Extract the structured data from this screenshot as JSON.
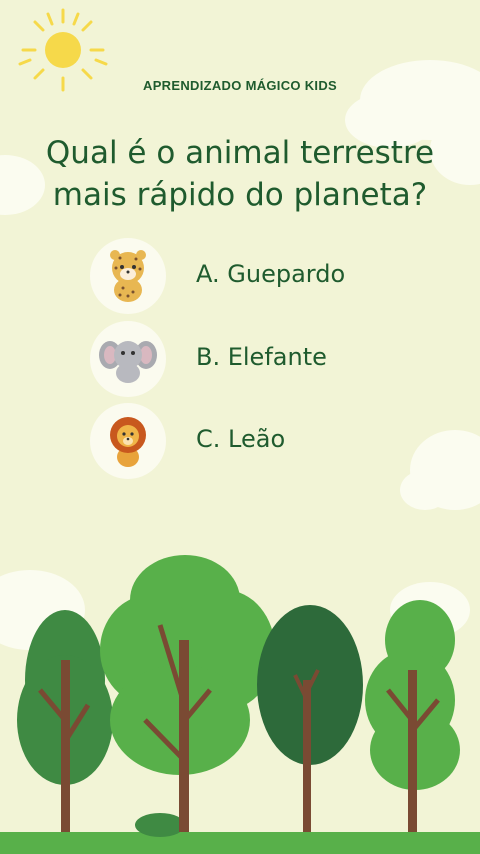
{
  "header": {
    "brand": "APRENDIZADO MÁGICO KIDS"
  },
  "question": {
    "line1": "Qual é o animal terrestre",
    "line2": "mais rápido do planeta?"
  },
  "options": [
    {
      "label": "A. Guepardo",
      "icon": "cheetah-icon"
    },
    {
      "label": "B. Elefante",
      "icon": "elephant-icon"
    },
    {
      "label": "C. Leão",
      "icon": "lion-icon"
    }
  ],
  "colors": {
    "background": "#f2f4d6",
    "text": "#1f5b2e",
    "sun": "#f6d94a",
    "tree_light": "#58b04a",
    "tree_dark": "#2d6a3a",
    "trunk": "#7a4a33"
  }
}
